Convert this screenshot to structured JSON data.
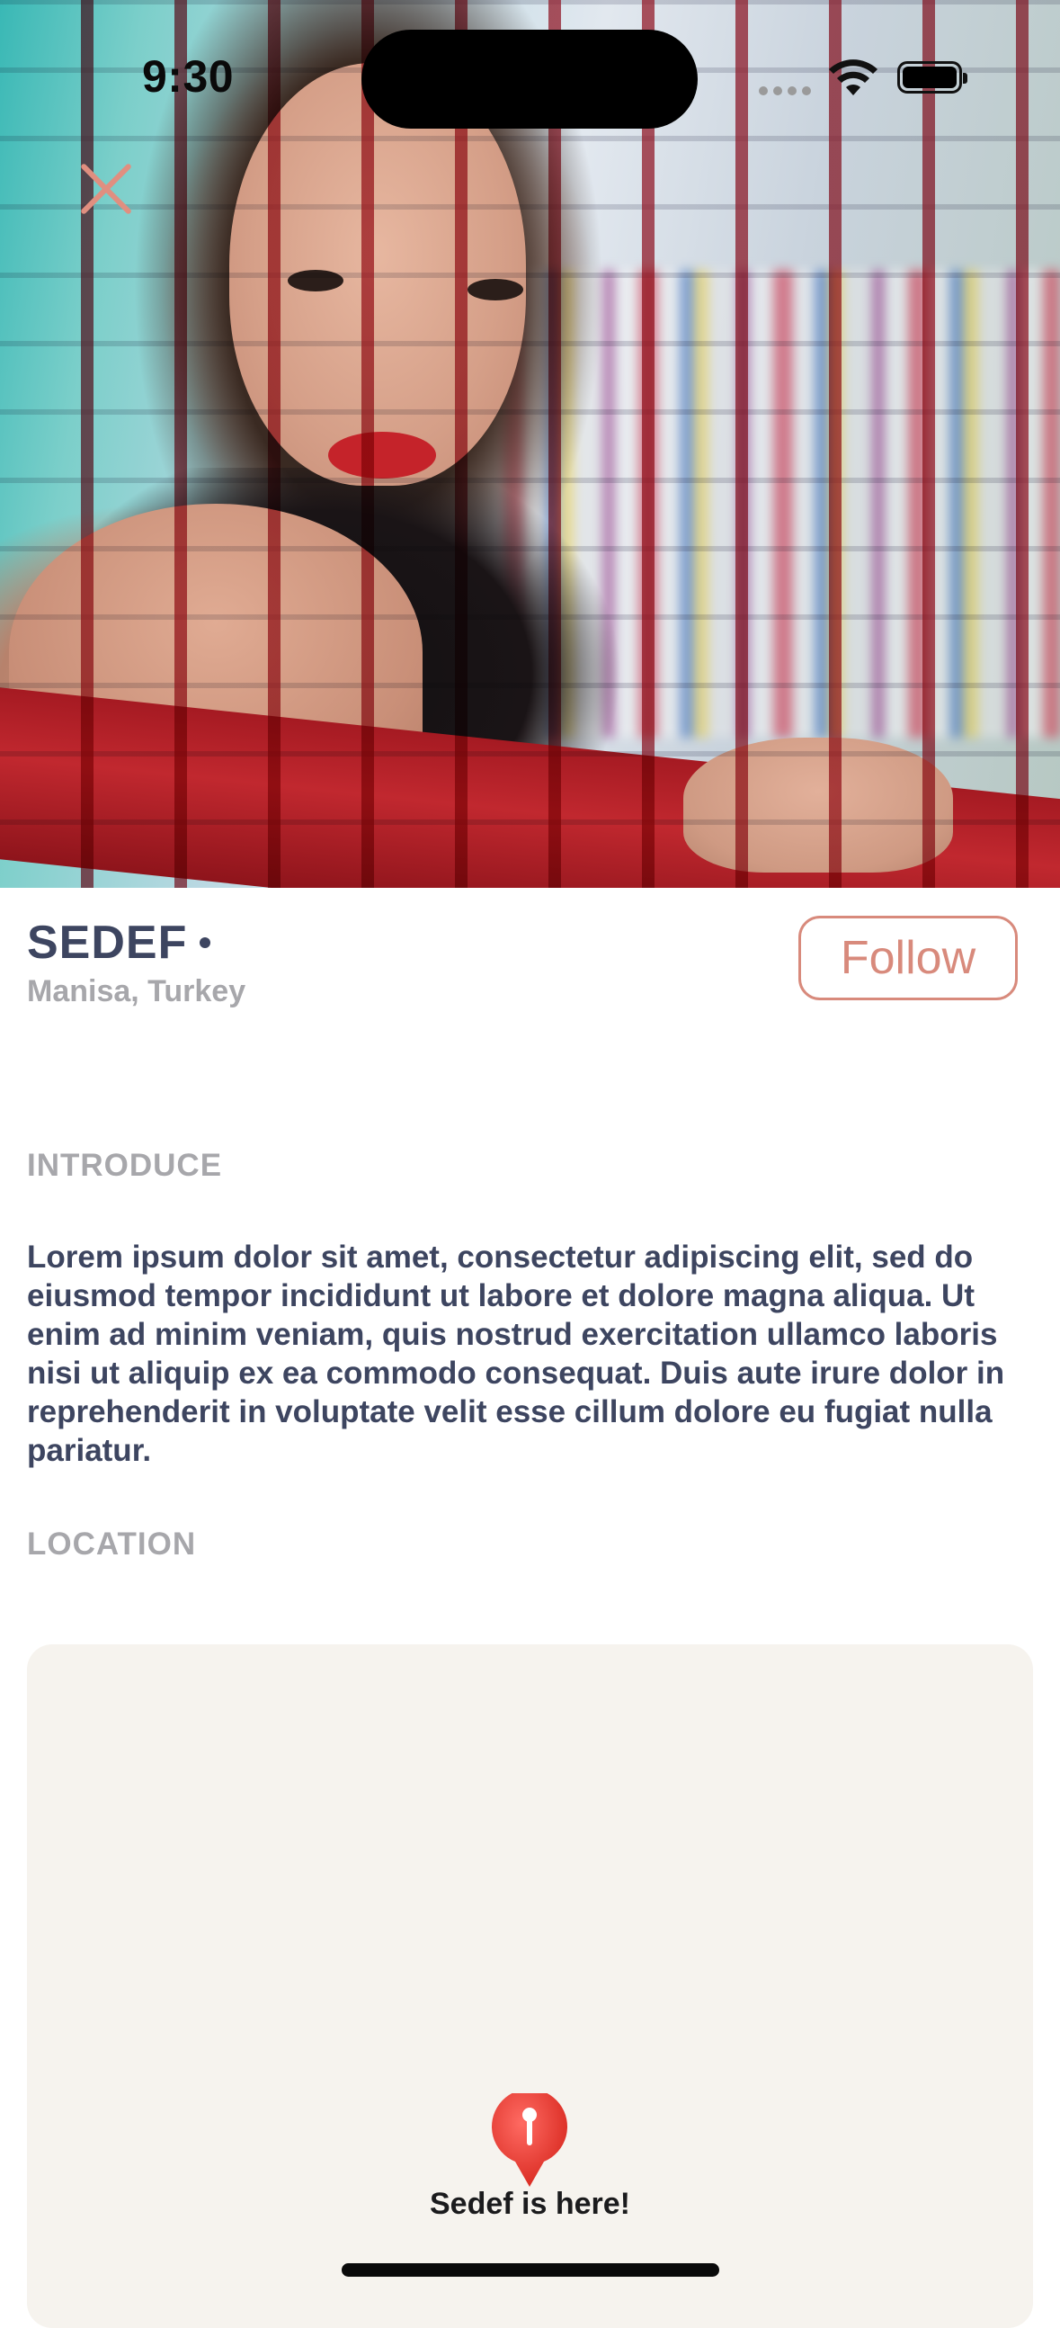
{
  "status_bar": {
    "time": "9:30"
  },
  "hero": {
    "icon": "profile-photo"
  },
  "nav": {
    "close_icon": "close-icon"
  },
  "profile": {
    "name": "SEDEF",
    "location": "Manisa, Turkey",
    "follow_label": "Follow"
  },
  "sections": {
    "introduce": {
      "title": "INTRODUCE",
      "body": "Lorem ipsum dolor sit amet, consectetur adipiscing elit, sed do eiusmod tempor incididunt ut labore et dolore magna aliqua. Ut enim ad minim veniam, quis nostrud exercitation ullamco laboris nisi ut aliquip ex ea commodo consequat. Duis aute irure dolor in reprehenderit in voluptate velit esse cillum dolore eu fugiat nulla pariatur."
    },
    "location": {
      "title": "LOCATION",
      "pin_label": "Sedef is here!"
    }
  },
  "colors": {
    "accent": "#d88a7c",
    "text_primary": "#3d4560",
    "text_muted": "#a7a7ab",
    "map_background": "#f6f3ee",
    "pin": "#e53935"
  }
}
